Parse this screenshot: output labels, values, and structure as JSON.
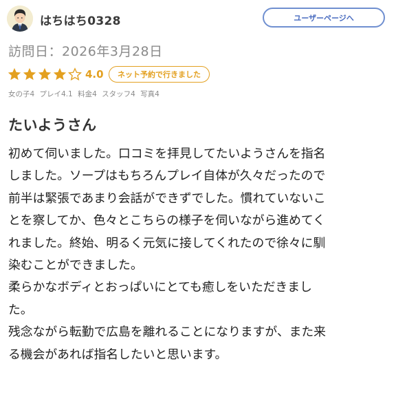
{
  "header": {
    "username": "はちはち0328",
    "user_page_button": "ユーザーページへ"
  },
  "visit": {
    "date_text": "訪問日：2026年3月28日"
  },
  "rating": {
    "stars_filled": 4,
    "stars_total": 5,
    "score": "4.0",
    "badge": "ネット予約で行きました",
    "sub_scores": [
      "女の子4",
      "プレイ4.1",
      "料金4",
      "スタッフ4",
      "写真4"
    ]
  },
  "review": {
    "title": "たいようさん",
    "lines": [
      "初めて伺いました。口コミを拝見してたいようさんを指名",
      "しました。ソープはもちろんプレイ自体が久々だったので",
      "前半は緊張であまり会話ができずでした。慣れていないこ",
      "とを察してか、色々とこちらの様子を伺いながら進めてく",
      "れました。終始、明るく元気に接してくれたので徐々に馴",
      "染むことができました。",
      "柔らかなボディとおっぱいにとても癒しをいただきまし",
      "た。",
      "残念ながら転勤で広島を離れることになりますが、また来",
      "る機会があれば指名したいと思います。"
    ]
  },
  "colors": {
    "accent_orange": "#e3a020",
    "button_blue": "#4a6cc0",
    "muted_gray": "#8a8a8a"
  },
  "icons": {
    "avatar": "person-avatar-icon",
    "star_filled": "star-filled-icon",
    "star_empty": "star-outline-icon"
  }
}
